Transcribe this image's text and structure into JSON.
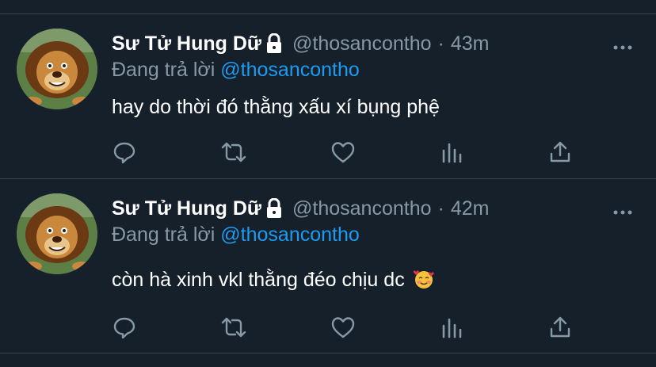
{
  "tweets": [
    {
      "display_name": "Sư Tử Hung Dữ",
      "handle": "@thosancontho",
      "separator": "·",
      "time": "43m",
      "reply_prefix": "Đang trả lời",
      "reply_to": "@thosancontho",
      "text": "hay do thời đó thằng xấu xí bụng phệ",
      "emoji": ""
    },
    {
      "display_name": "Sư Tử Hung Dữ",
      "handle": "@thosancontho",
      "separator": "·",
      "time": "42m",
      "reply_prefix": "Đang trả lời",
      "reply_to": "@thosancontho",
      "text": "còn hà xinh vkl thằng đéo chịu dc",
      "emoji": "smiling-face-with-hearts"
    }
  ],
  "icons": {
    "lock": "lock-icon",
    "more": "more-icon",
    "reply": "reply-icon",
    "retweet": "retweet-icon",
    "like": "like-icon",
    "analytics": "analytics-icon",
    "share": "share-icon",
    "avatar": "lion-avatar"
  },
  "colors": {
    "background": "#15202b",
    "divider": "#38444d",
    "text_primary": "#ffffff",
    "text_secondary": "#8899a6",
    "accent": "#1d9bf0"
  }
}
